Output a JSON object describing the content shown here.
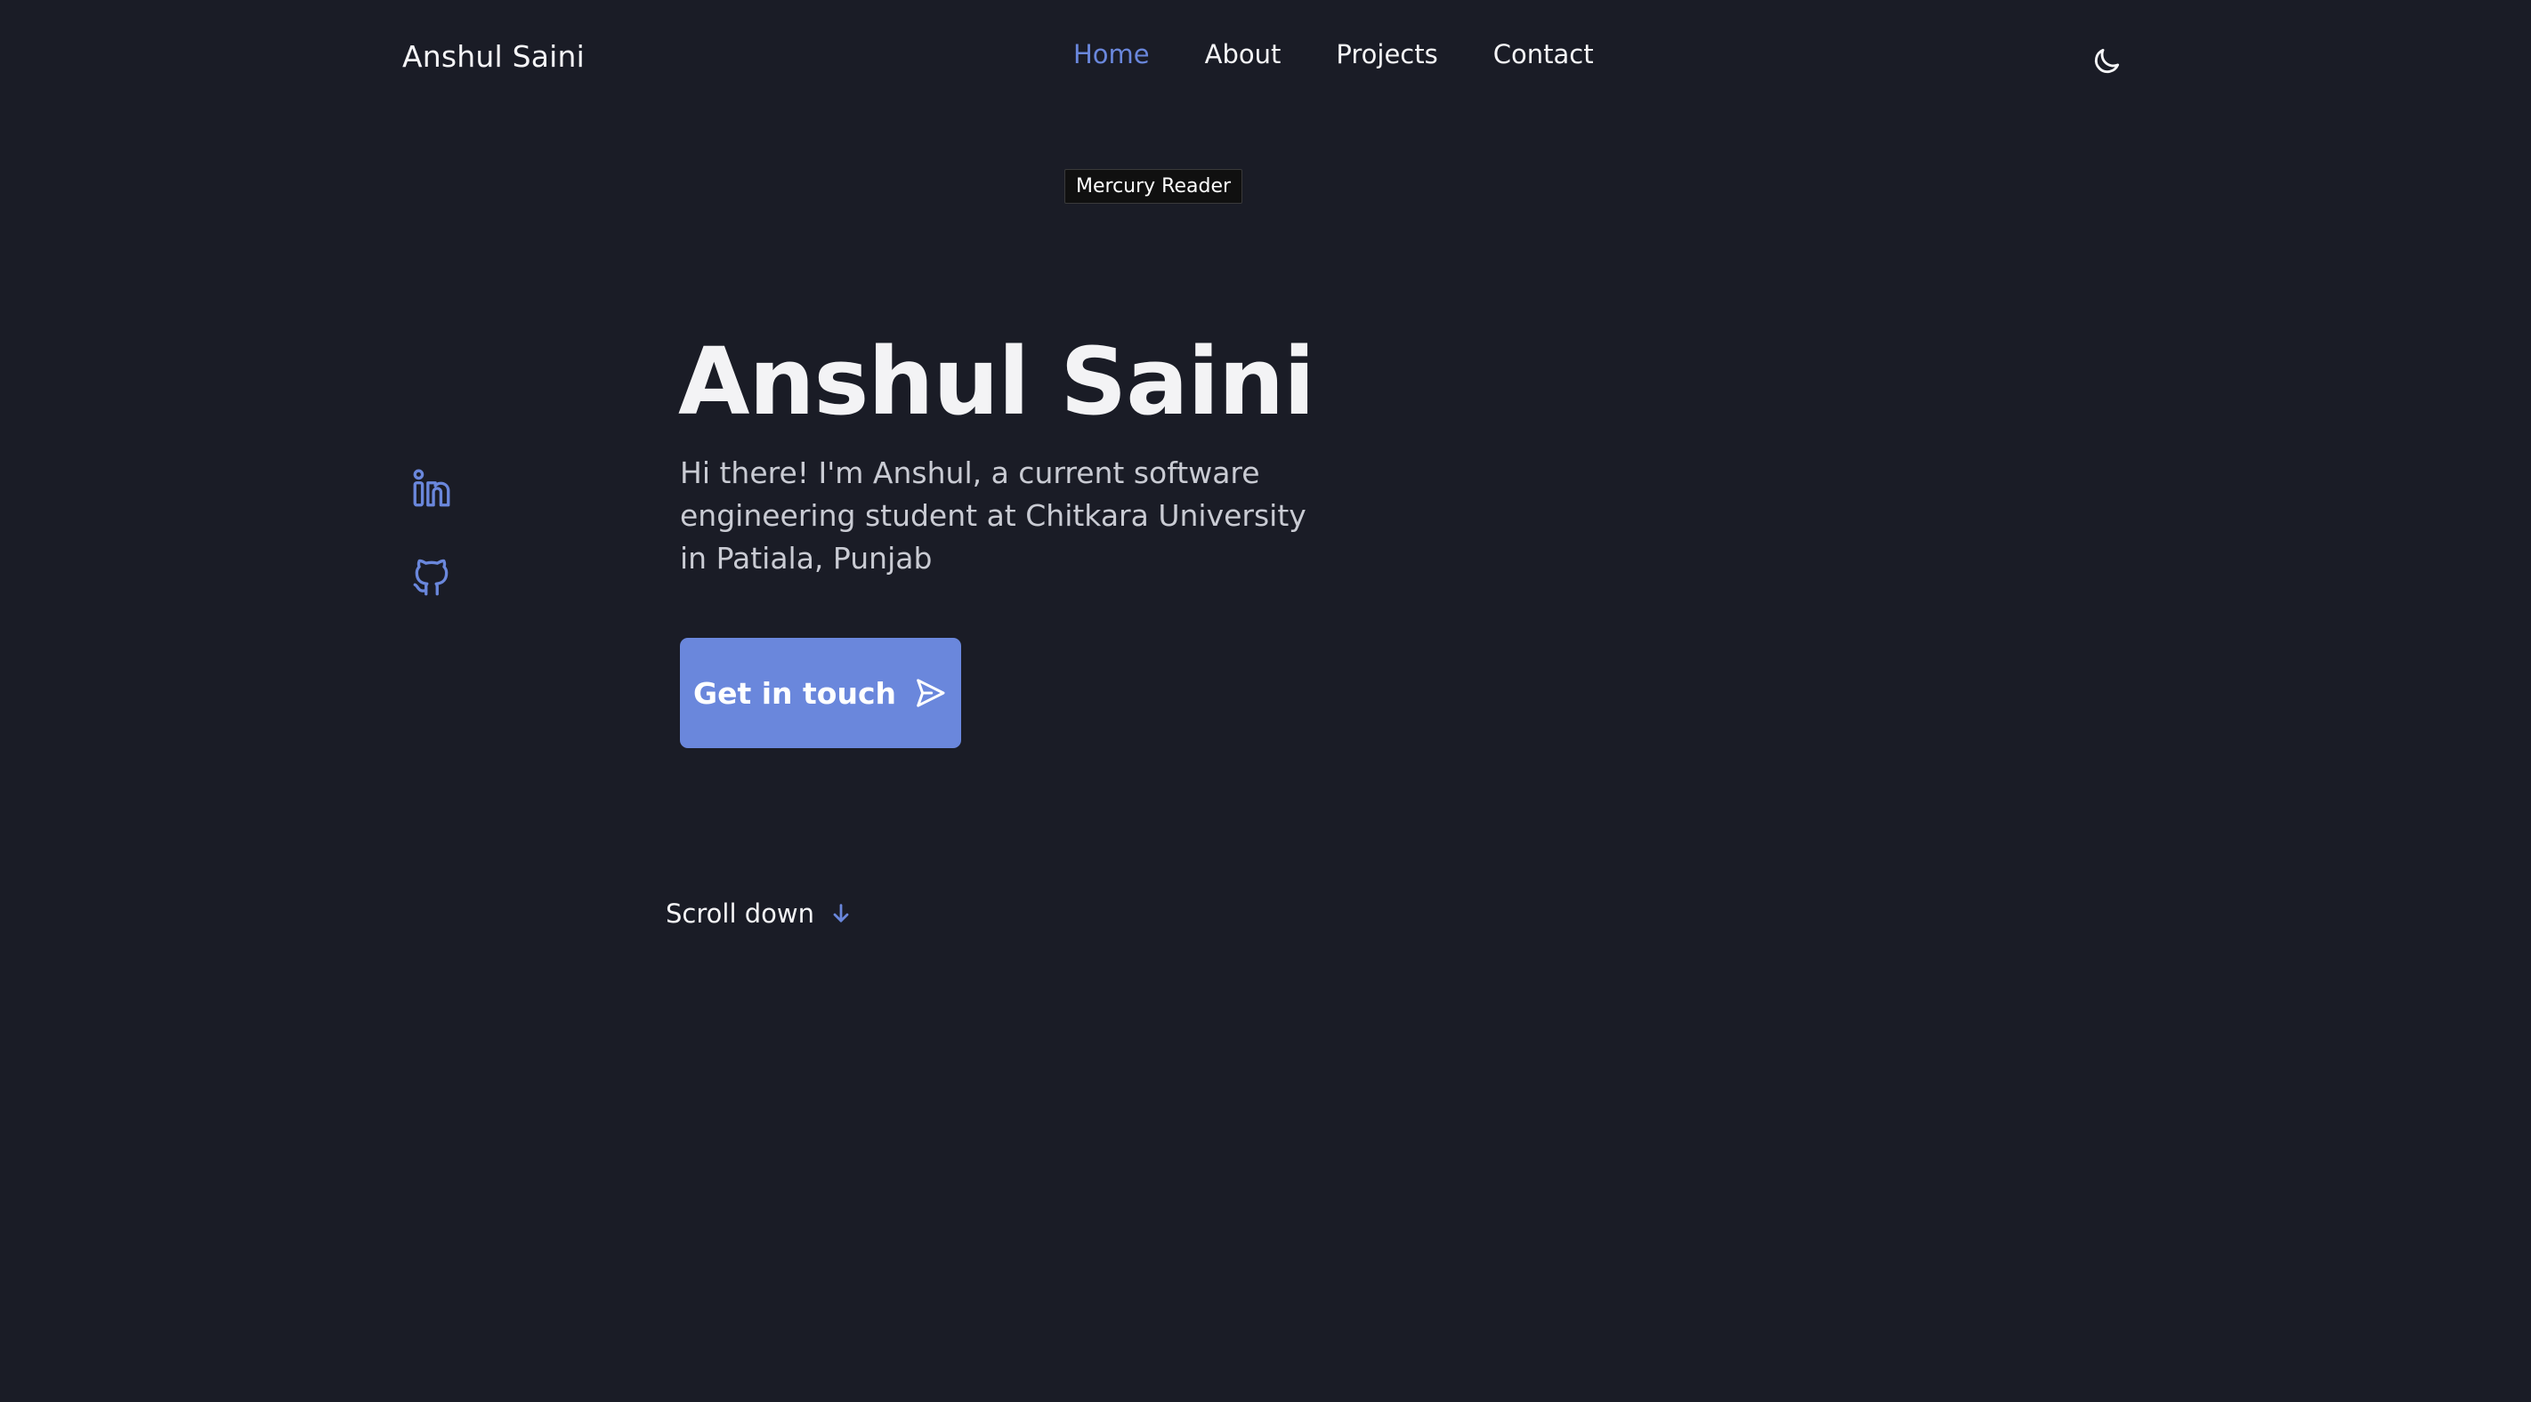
{
  "header": {
    "brand": "Anshul Saini",
    "nav": [
      {
        "label": "Home",
        "active": true
      },
      {
        "label": "About",
        "active": false
      },
      {
        "label": "Projects",
        "active": false
      },
      {
        "label": "Contact",
        "active": false
      }
    ],
    "theme_toggle_icon": "moon-icon"
  },
  "tooltip": {
    "text": "Mercury Reader"
  },
  "social": {
    "items": [
      {
        "icon": "linkedin-icon"
      },
      {
        "icon": "github-icon"
      }
    ]
  },
  "hero": {
    "title": "Anshul Saini",
    "description": "Hi there! I'm Anshul, a current software engineering student at Chitkara University in Patiala, Punjab",
    "cta_label": "Get in touch",
    "cta_icon": "send-icon",
    "scroll_label": "Scroll down",
    "scroll_icon": "arrow-down-icon"
  },
  "colors": {
    "background": "#1a1c26",
    "accent": "#6a87dc",
    "text": "#f5f5f7",
    "muted_text": "#c9cbd3"
  }
}
